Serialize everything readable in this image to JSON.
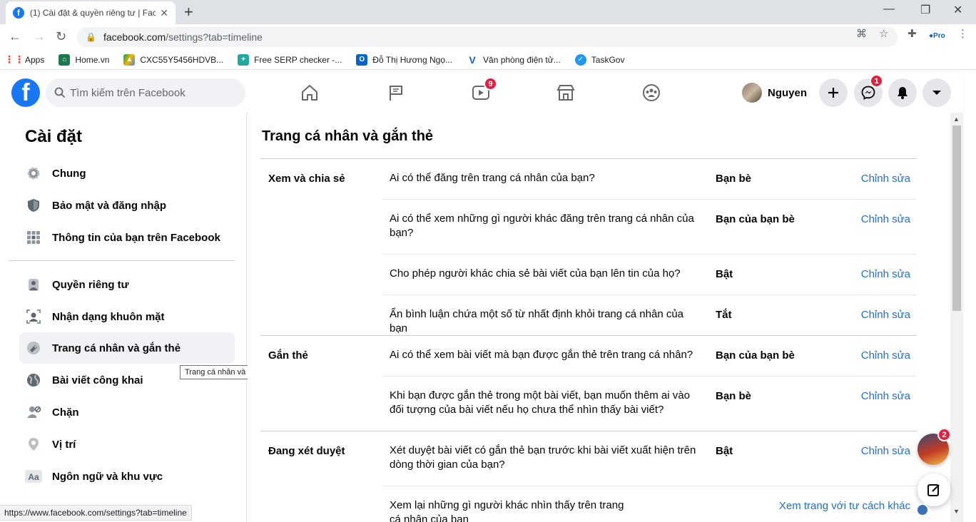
{
  "browser": {
    "tab_title": "(1) Cài đặt & quyền riêng tư | Fac",
    "url_host": "facebook.com",
    "url_path": "/settings?tab=timeline",
    "bookmarks": [
      {
        "label": "Apps",
        "color": "#e8453c"
      },
      {
        "label": "Home.vn",
        "color": "#1a7a4c"
      },
      {
        "label": "CXC55Y5456HDVB...",
        "color": "#f4b400"
      },
      {
        "label": "Free SERP checker -...",
        "color": "#23a8a0"
      },
      {
        "label": "Đỗ Thị Hương Ngọ...",
        "color": "#0a64c2"
      },
      {
        "label": "Văn phòng điện tử...",
        "color": "#1565c0"
      },
      {
        "label": "TaskGov",
        "color": "#2196f3"
      }
    ],
    "status_url": "https://www.facebook.com/settings?tab=timeline"
  },
  "fb": {
    "search_placeholder": "Tìm kiếm trên Facebook",
    "watch_badge": "9",
    "profile_name": "Nguyen",
    "messenger_badge": "1",
    "chat_badge": "2",
    "brand_color": "#1877f2"
  },
  "sidebar": {
    "title": "Cài đặt",
    "group1": [
      {
        "label": "Chung",
        "icon": "gear-icon"
      },
      {
        "label": "Bảo mật và đăng nhập",
        "icon": "shield-icon"
      },
      {
        "label": "Thông tin của bạn trên Facebook",
        "icon": "grid-icon"
      }
    ],
    "group2": [
      {
        "label": "Quyền riêng tư",
        "icon": "lock-person-icon"
      },
      {
        "label": "Nhận dạng khuôn mặt",
        "icon": "face-recognition-icon"
      },
      {
        "label": "Trang cá nhân và gắn thẻ",
        "icon": "tag-icon"
      },
      {
        "label": "Bài viết công khai",
        "icon": "globe-icon"
      },
      {
        "label": "Chặn",
        "icon": "block-user-icon"
      },
      {
        "label": "Vị trí",
        "icon": "location-pin-icon"
      },
      {
        "label": "Ngôn ngữ và khu vực",
        "icon": "language-icon"
      }
    ],
    "tooltip": "Trang cá nhân và gắn thẻ"
  },
  "main": {
    "title": "Trang cá nhân và gắn thẻ",
    "sections": [
      {
        "label": "Xem và chia sẻ",
        "rows": [
          {
            "question": "Ai có thể đăng trên trang cá nhân của bạn?",
            "value": "Bạn bè",
            "action": "Chỉnh sửa"
          },
          {
            "question": "Ai có thể xem những gì người khác đăng trên trang cá nhân của bạn?",
            "value": "Bạn của bạn bè",
            "action": "Chỉnh sửa"
          },
          {
            "question": "Cho phép người khác chia sẻ bài viết của bạn lên tin của họ?",
            "value": "Bật",
            "action": "Chỉnh sửa"
          },
          {
            "question": "Ẩn bình luận chứa một số từ nhất định khỏi trang cá nhân của bạn",
            "value": "Tắt",
            "action": "Chỉnh sửa"
          }
        ]
      },
      {
        "label": "Gắn thẻ",
        "rows": [
          {
            "question": "Ai có thể xem bài viết mà bạn được gắn thẻ trên trang cá nhân?",
            "value": "Bạn của bạn bè",
            "action": "Chỉnh sửa"
          },
          {
            "question": "Khi bạn được gắn thẻ trong một bài viết, bạn muốn thêm ai vào đối tượng của bài viết nếu họ chưa thể nhìn thấy bài viết?",
            "value": "Bạn bè",
            "action": "Chỉnh sửa"
          }
        ]
      },
      {
        "label": "Đang xét duyệt",
        "rows": [
          {
            "question": "Xét duyệt bài viết có gắn thẻ bạn trước khi bài viết xuất hiện trên dòng thời gian của bạn?",
            "value": "Bật",
            "action": "Chỉnh sửa"
          },
          {
            "question": "Xem lại những gì người khác nhìn thấy trên trang cá nhân của bạn",
            "value": "",
            "action": "Xem trang với tư cách khác"
          }
        ]
      }
    ]
  }
}
